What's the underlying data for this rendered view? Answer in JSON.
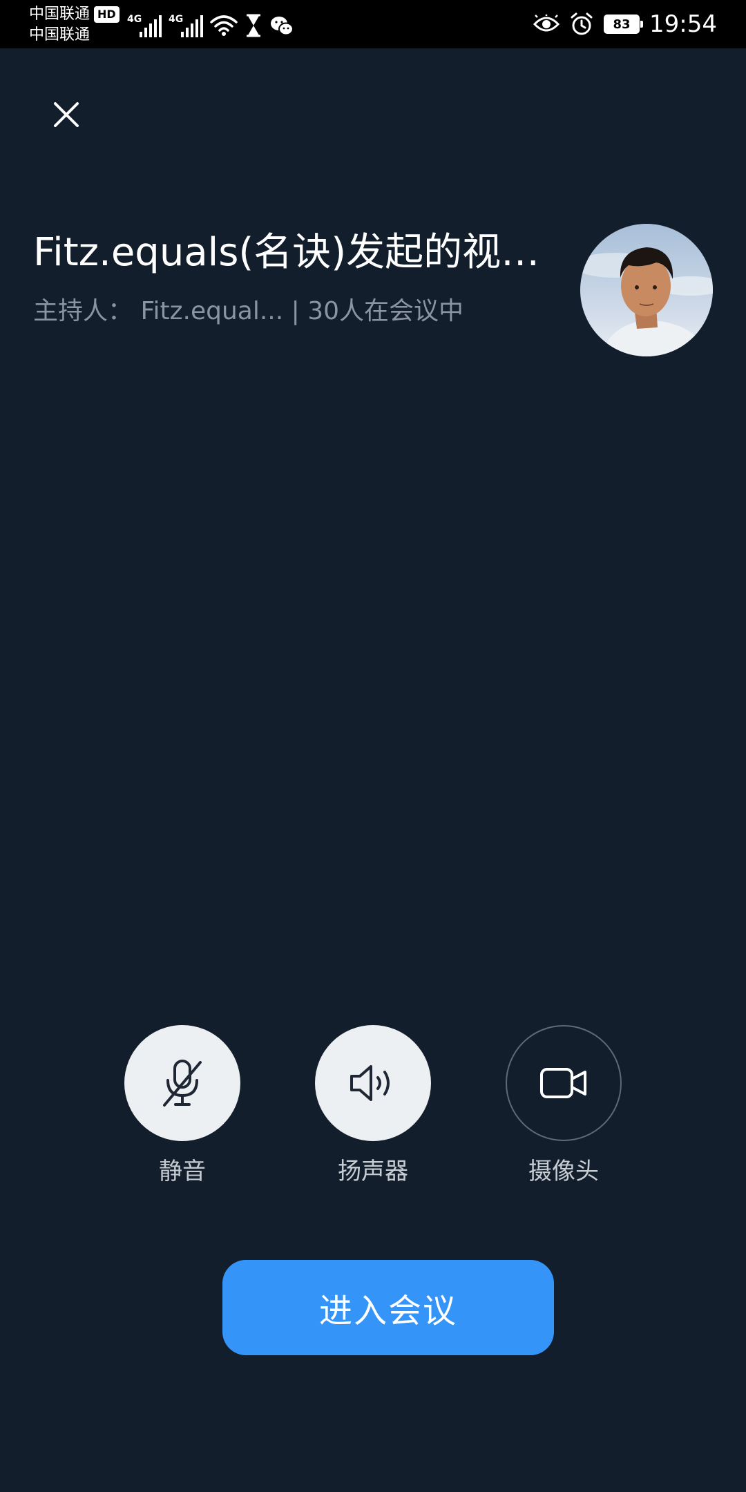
{
  "status_bar": {
    "carrier_1": "中国联通",
    "carrier_2": "中国联通",
    "hd": "HD",
    "network_1": "4G",
    "network_2": "4G",
    "battery": "83",
    "time": "19:54"
  },
  "header": {
    "title": "Fitz.equals(名诀)发起的视…",
    "subtitle": "主持人：  Fitz.equal... | 30人在会议中"
  },
  "controls": {
    "mute_label": "静音",
    "speaker_label": "扬声器",
    "camera_label": "摄像头"
  },
  "join_button_label": "进入会议",
  "colors": {
    "background": "#121e2b",
    "accent": "#3594f7",
    "control_bg": "#edf0f3"
  }
}
